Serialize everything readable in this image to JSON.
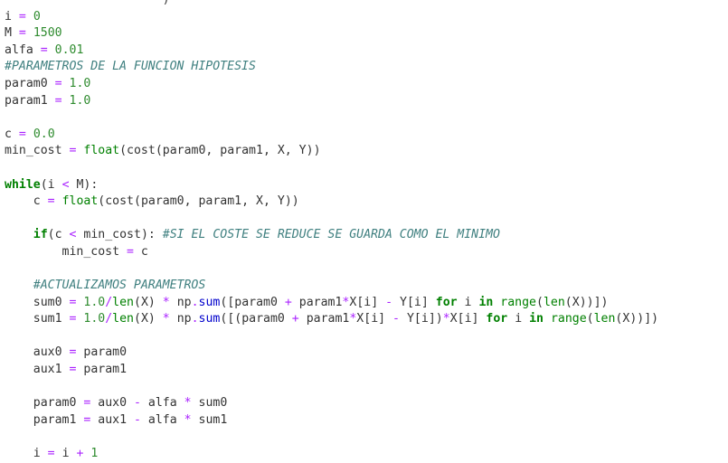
{
  "editor": {
    "language": "python",
    "colors": {
      "background": "#ffffff",
      "name": "#333333",
      "number": "#2e8b2e",
      "operator": "#aa22ff",
      "keyword": "#008000",
      "builtin": "#008000",
      "attribute": "#0000cc",
      "comment": "#408080"
    },
    "lines": [
      [
        [
          "p",
          "                      )"
        ]
      ],
      [
        [
          "n",
          "i"
        ],
        [
          "p",
          " "
        ],
        [
          "o",
          "="
        ],
        [
          "p",
          " "
        ],
        [
          "num",
          "0"
        ]
      ],
      [
        [
          "n",
          "M"
        ],
        [
          "p",
          " "
        ],
        [
          "o",
          "="
        ],
        [
          "p",
          " "
        ],
        [
          "num",
          "1500"
        ]
      ],
      [
        [
          "n",
          "alfa"
        ],
        [
          "p",
          " "
        ],
        [
          "o",
          "="
        ],
        [
          "p",
          " "
        ],
        [
          "num",
          "0.01"
        ]
      ],
      [
        [
          "c",
          "#PARAMETROS DE LA FUNCION HIPOTESIS"
        ]
      ],
      [
        [
          "n",
          "param0"
        ],
        [
          "p",
          " "
        ],
        [
          "o",
          "="
        ],
        [
          "p",
          " "
        ],
        [
          "num",
          "1.0"
        ]
      ],
      [
        [
          "n",
          "param1"
        ],
        [
          "p",
          " "
        ],
        [
          "o",
          "="
        ],
        [
          "p",
          " "
        ],
        [
          "num",
          "1.0"
        ]
      ],
      [
        [
          "p",
          ""
        ]
      ],
      [
        [
          "n",
          "c"
        ],
        [
          "p",
          " "
        ],
        [
          "o",
          "="
        ],
        [
          "p",
          " "
        ],
        [
          "num",
          "0.0"
        ]
      ],
      [
        [
          "n",
          "min_cost"
        ],
        [
          "p",
          " "
        ],
        [
          "o",
          "="
        ],
        [
          "p",
          " "
        ],
        [
          "b",
          "float"
        ],
        [
          "p",
          "("
        ],
        [
          "n",
          "cost"
        ],
        [
          "p",
          "("
        ],
        [
          "n",
          "param0"
        ],
        [
          "p",
          ", "
        ],
        [
          "n",
          "param1"
        ],
        [
          "p",
          ", "
        ],
        [
          "n",
          "X"
        ],
        [
          "p",
          ", "
        ],
        [
          "n",
          "Y"
        ],
        [
          "p",
          "))"
        ]
      ],
      [
        [
          "p",
          ""
        ]
      ],
      [
        [
          "k",
          "while"
        ],
        [
          "p",
          "("
        ],
        [
          "n",
          "i"
        ],
        [
          "p",
          " "
        ],
        [
          "o",
          "<"
        ],
        [
          "p",
          " "
        ],
        [
          "n",
          "M"
        ],
        [
          "p",
          "):"
        ]
      ],
      [
        [
          "p",
          "    "
        ],
        [
          "n",
          "c"
        ],
        [
          "p",
          " "
        ],
        [
          "o",
          "="
        ],
        [
          "p",
          " "
        ],
        [
          "b",
          "float"
        ],
        [
          "p",
          "("
        ],
        [
          "n",
          "cost"
        ],
        [
          "p",
          "("
        ],
        [
          "n",
          "param0"
        ],
        [
          "p",
          ", "
        ],
        [
          "n",
          "param1"
        ],
        [
          "p",
          ", "
        ],
        [
          "n",
          "X"
        ],
        [
          "p",
          ", "
        ],
        [
          "n",
          "Y"
        ],
        [
          "p",
          "))"
        ]
      ],
      [
        [
          "p",
          ""
        ]
      ],
      [
        [
          "p",
          "    "
        ],
        [
          "k",
          "if"
        ],
        [
          "p",
          "("
        ],
        [
          "n",
          "c"
        ],
        [
          "p",
          " "
        ],
        [
          "o",
          "<"
        ],
        [
          "p",
          " "
        ],
        [
          "n",
          "min_cost"
        ],
        [
          "p",
          "): "
        ],
        [
          "c",
          "#SI EL COSTE SE REDUCE SE GUARDA COMO EL MINIMO"
        ]
      ],
      [
        [
          "p",
          "        "
        ],
        [
          "n",
          "min_cost"
        ],
        [
          "p",
          " "
        ],
        [
          "o",
          "="
        ],
        [
          "p",
          " "
        ],
        [
          "n",
          "c"
        ]
      ],
      [
        [
          "p",
          ""
        ]
      ],
      [
        [
          "p",
          "    "
        ],
        [
          "c",
          "#ACTUALIZAMOS PARAMETROS"
        ]
      ],
      [
        [
          "p",
          "    "
        ],
        [
          "n",
          "sum0"
        ],
        [
          "p",
          " "
        ],
        [
          "o",
          "="
        ],
        [
          "p",
          " "
        ],
        [
          "num",
          "1.0"
        ],
        [
          "o",
          "/"
        ],
        [
          "b",
          "len"
        ],
        [
          "p",
          "("
        ],
        [
          "n",
          "X"
        ],
        [
          "p",
          ") "
        ],
        [
          "o",
          "*"
        ],
        [
          "p",
          " "
        ],
        [
          "n",
          "np"
        ],
        [
          "o",
          "."
        ],
        [
          "f",
          "sum"
        ],
        [
          "p",
          "(["
        ],
        [
          "n",
          "param0"
        ],
        [
          "p",
          " "
        ],
        [
          "o",
          "+"
        ],
        [
          "p",
          " "
        ],
        [
          "n",
          "param1"
        ],
        [
          "o",
          "*"
        ],
        [
          "n",
          "X"
        ],
        [
          "p",
          "["
        ],
        [
          "n",
          "i"
        ],
        [
          "p",
          "] "
        ],
        [
          "o",
          "-"
        ],
        [
          "p",
          " "
        ],
        [
          "n",
          "Y"
        ],
        [
          "p",
          "["
        ],
        [
          "n",
          "i"
        ],
        [
          "p",
          "] "
        ],
        [
          "k",
          "for"
        ],
        [
          "p",
          " "
        ],
        [
          "n",
          "i"
        ],
        [
          "p",
          " "
        ],
        [
          "k",
          "in"
        ],
        [
          "p",
          " "
        ],
        [
          "b",
          "range"
        ],
        [
          "p",
          "("
        ],
        [
          "b",
          "len"
        ],
        [
          "p",
          "("
        ],
        [
          "n",
          "X"
        ],
        [
          "p",
          "))])"
        ]
      ],
      [
        [
          "p",
          "    "
        ],
        [
          "n",
          "sum1"
        ],
        [
          "p",
          " "
        ],
        [
          "o",
          "="
        ],
        [
          "p",
          " "
        ],
        [
          "num",
          "1.0"
        ],
        [
          "o",
          "/"
        ],
        [
          "b",
          "len"
        ],
        [
          "p",
          "("
        ],
        [
          "n",
          "X"
        ],
        [
          "p",
          ") "
        ],
        [
          "o",
          "*"
        ],
        [
          "p",
          " "
        ],
        [
          "n",
          "np"
        ],
        [
          "o",
          "."
        ],
        [
          "f",
          "sum"
        ],
        [
          "p",
          "([("
        ],
        [
          "n",
          "param0"
        ],
        [
          "p",
          " "
        ],
        [
          "o",
          "+"
        ],
        [
          "p",
          " "
        ],
        [
          "n",
          "param1"
        ],
        [
          "o",
          "*"
        ],
        [
          "n",
          "X"
        ],
        [
          "p",
          "["
        ],
        [
          "n",
          "i"
        ],
        [
          "p",
          "] "
        ],
        [
          "o",
          "-"
        ],
        [
          "p",
          " "
        ],
        [
          "n",
          "Y"
        ],
        [
          "p",
          "["
        ],
        [
          "n",
          "i"
        ],
        [
          "p",
          "])"
        ],
        [
          "o",
          "*"
        ],
        [
          "n",
          "X"
        ],
        [
          "p",
          "["
        ],
        [
          "n",
          "i"
        ],
        [
          "p",
          "] "
        ],
        [
          "k",
          "for"
        ],
        [
          "p",
          " "
        ],
        [
          "n",
          "i"
        ],
        [
          "p",
          " "
        ],
        [
          "k",
          "in"
        ],
        [
          "p",
          " "
        ],
        [
          "b",
          "range"
        ],
        [
          "p",
          "("
        ],
        [
          "b",
          "len"
        ],
        [
          "p",
          "("
        ],
        [
          "n",
          "X"
        ],
        [
          "p",
          "))])"
        ]
      ],
      [
        [
          "p",
          ""
        ]
      ],
      [
        [
          "p",
          "    "
        ],
        [
          "n",
          "aux0"
        ],
        [
          "p",
          " "
        ],
        [
          "o",
          "="
        ],
        [
          "p",
          " "
        ],
        [
          "n",
          "param0"
        ]
      ],
      [
        [
          "p",
          "    "
        ],
        [
          "n",
          "aux1"
        ],
        [
          "p",
          " "
        ],
        [
          "o",
          "="
        ],
        [
          "p",
          " "
        ],
        [
          "n",
          "param1"
        ]
      ],
      [
        [
          "p",
          ""
        ]
      ],
      [
        [
          "p",
          "    "
        ],
        [
          "n",
          "param0"
        ],
        [
          "p",
          " "
        ],
        [
          "o",
          "="
        ],
        [
          "p",
          " "
        ],
        [
          "n",
          "aux0"
        ],
        [
          "p",
          " "
        ],
        [
          "o",
          "-"
        ],
        [
          "p",
          " "
        ],
        [
          "n",
          "alfa"
        ],
        [
          "p",
          " "
        ],
        [
          "o",
          "*"
        ],
        [
          "p",
          " "
        ],
        [
          "n",
          "sum0"
        ]
      ],
      [
        [
          "p",
          "    "
        ],
        [
          "n",
          "param1"
        ],
        [
          "p",
          " "
        ],
        [
          "o",
          "="
        ],
        [
          "p",
          " "
        ],
        [
          "n",
          "aux1"
        ],
        [
          "p",
          " "
        ],
        [
          "o",
          "-"
        ],
        [
          "p",
          " "
        ],
        [
          "n",
          "alfa"
        ],
        [
          "p",
          " "
        ],
        [
          "o",
          "*"
        ],
        [
          "p",
          " "
        ],
        [
          "n",
          "sum1"
        ]
      ],
      [
        [
          "p",
          ""
        ]
      ],
      [
        [
          "p",
          "    "
        ],
        [
          "n",
          "i"
        ],
        [
          "p",
          " "
        ],
        [
          "o",
          "="
        ],
        [
          "p",
          " "
        ],
        [
          "n",
          "i"
        ],
        [
          "p",
          " "
        ],
        [
          "o",
          "+"
        ],
        [
          "p",
          " "
        ],
        [
          "num",
          "1"
        ]
      ]
    ]
  }
}
